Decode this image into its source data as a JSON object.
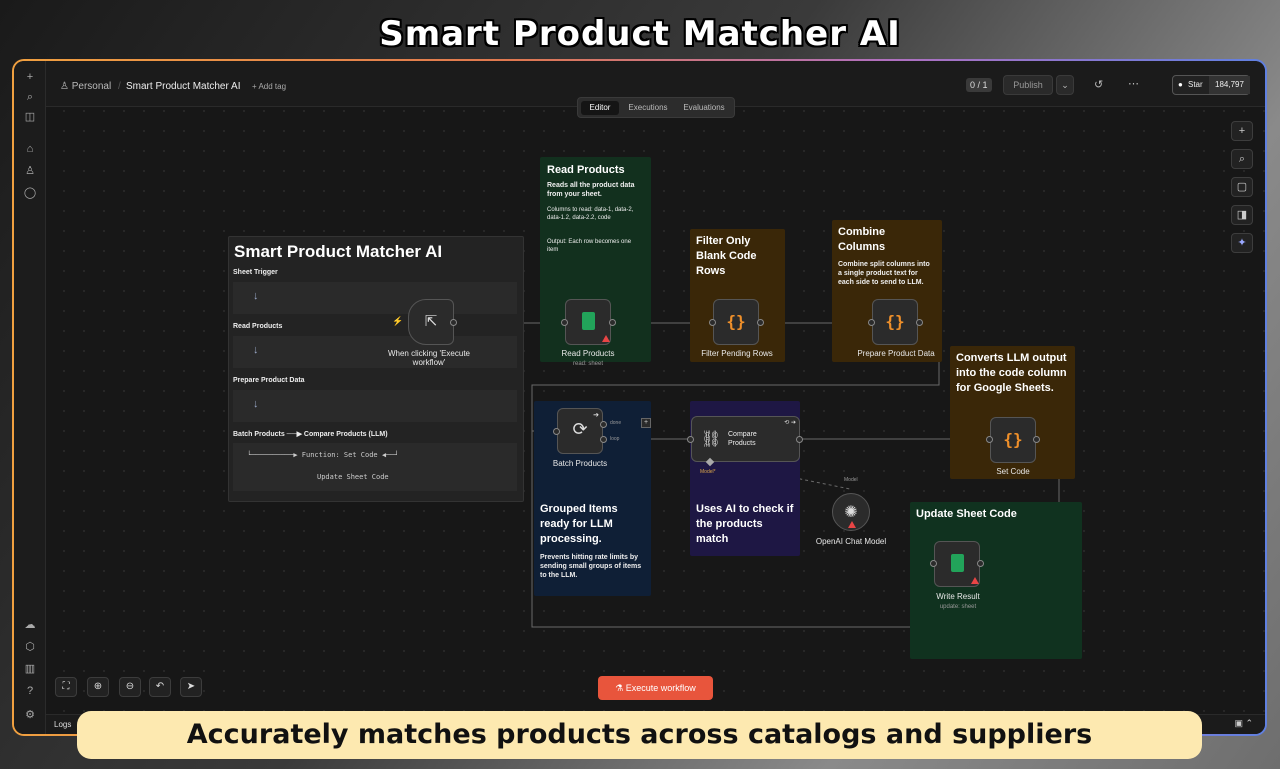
{
  "banner": {
    "title": "Smart Product Matcher AI",
    "caption": "Accurately matches products across catalogs and suppliers"
  },
  "header": {
    "breadcrumb_home": "Personal",
    "workflow_name": "Smart Product Matcher AI",
    "add_tag": "+ Add tag",
    "counter": "0 / 1",
    "publish": "Publish",
    "star_label": "Star",
    "star_count": "184,797"
  },
  "tabs": [
    {
      "label": "Editor"
    },
    {
      "label": "Executions"
    },
    {
      "label": "Evaluations"
    }
  ],
  "overview": {
    "title": "Smart Product Matcher AI",
    "sections": [
      {
        "label": "Sheet Trigger"
      },
      {
        "label": "Read Products"
      },
      {
        "label": "Prepare Product Data"
      },
      {
        "label": "Batch Products ──▶ Compare Products (LLM)"
      }
    ],
    "mini_line1": "└──────────▶ Function: Set Code ◀──┘",
    "mini_line2": "Update Sheet Code"
  },
  "stickies": {
    "read": {
      "title": "Read Products",
      "line1": "Reads all the product data from your sheet.",
      "line2": "Columns to read: data-1, data-2, data-1.2, data-2.2, code",
      "line3": "Output: Each row becomes one item"
    },
    "filter": {
      "title": "Filter Only Blank Code Rows"
    },
    "combine": {
      "title": "Combine Columns",
      "body": "Combine split columns into a single product text for each side to send to LLM."
    },
    "convert": {
      "title": "Converts LLM output into the code column for Google Sheets."
    },
    "grouped": {
      "title": "Grouped Items ready for LLM processing.",
      "body": "Prevents hitting rate limits by sending small groups of items to the LLM."
    },
    "ai": {
      "title": "Uses AI to check if the products match"
    },
    "update": {
      "title": "Update Sheet Code"
    }
  },
  "nodes": {
    "trigger": {
      "label": "When clicking 'Execute workflow'"
    },
    "read": {
      "label": "Read Products",
      "sub": "read: sheet"
    },
    "filter": {
      "label": "Filter Pending Rows"
    },
    "prepare": {
      "label": "Prepare Product Data"
    },
    "batch": {
      "label": "Batch Products",
      "done": "done",
      "loop": "loop"
    },
    "compare": {
      "label_line1": "Compare",
      "label_line2": "Products",
      "model_port": "Model*"
    },
    "openai": {
      "label": "OpenAI Chat Model",
      "model_tag": "Model"
    },
    "setcode": {
      "label": "Set Code"
    },
    "write": {
      "label": "Write Result",
      "sub": "update: sheet"
    }
  },
  "footer": {
    "execute": "Execute workflow",
    "logs": "Logs"
  },
  "colors": {
    "accent": "#e8553c",
    "sheets_green": "#22a35a",
    "code_orange": "#f0902a",
    "warn_red": "#e84545"
  }
}
